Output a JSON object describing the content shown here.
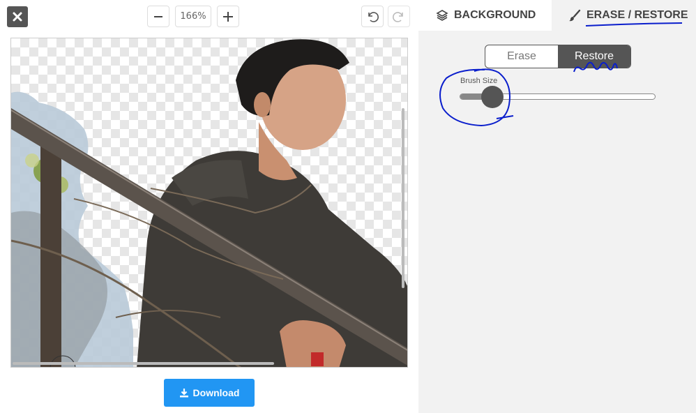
{
  "toolbar": {
    "zoom_value": "166%"
  },
  "tabs": {
    "background_label": "BACKGROUND",
    "erase_restore_label": "ERASE / RESTORE"
  },
  "mode": {
    "erase_label": "Erase",
    "restore_label": "Restore",
    "active": "Restore"
  },
  "brush": {
    "label": "Brush Size",
    "level": 0.17
  },
  "download": {
    "label": "Download"
  },
  "icons": {
    "close": "close-icon",
    "zoom_out": "minus-icon",
    "zoom_in": "plus-icon",
    "undo": "undo-icon",
    "redo": "redo-icon",
    "background_tab": "layers-icon",
    "erase_tab": "brush-icon",
    "download": "download-icon"
  },
  "colors": {
    "accent": "#2196f3",
    "dark": "#555555",
    "panel": "#f2f2f2",
    "annotation": "#0a1ecc"
  }
}
